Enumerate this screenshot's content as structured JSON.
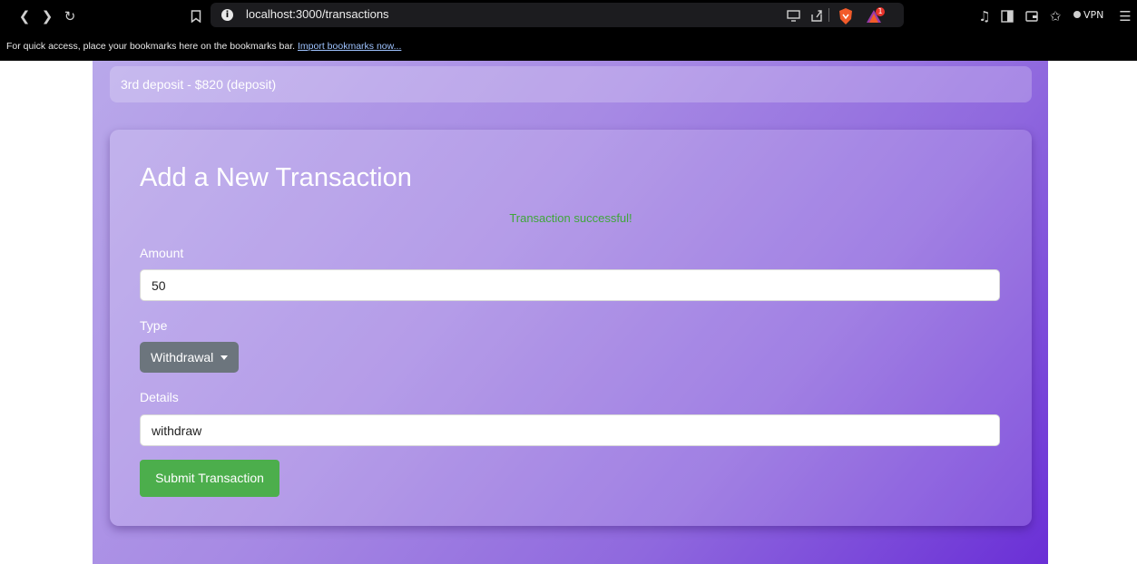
{
  "browser": {
    "url": "localhost:3000/transactions",
    "info_icon": "i",
    "bookmarks_bar": {
      "message": "For quick access, place your bookmarks here on the bookmarks bar.",
      "link": "Import bookmarks now..."
    },
    "vpn_label": "VPN",
    "notification_count": "1",
    "icons": [
      "back-icon",
      "forward-icon",
      "reload-icon",
      "bookmark-icon",
      "info-icon",
      "cast-icon",
      "share-icon",
      "brave-shields-icon",
      "brave-rewards-icon",
      "music-icon",
      "sidebar-icon",
      "wallet-icon",
      "bookmarks-star-icon",
      "vpn-icon",
      "menu-icon"
    ]
  },
  "transactions": {
    "last_item": "3rd deposit - $820 (deposit)"
  },
  "form": {
    "title": "Add a New Transaction",
    "status_message": "Transaction successful!",
    "status_color": "#3fa63a",
    "amount_label": "Amount",
    "amount_value": "50",
    "type_label": "Type",
    "type_selected": "Withdrawal",
    "details_label": "Details",
    "details_value": "withdraw",
    "submit_label": "Submit Transaction",
    "submit_color": "#4cae4c"
  }
}
